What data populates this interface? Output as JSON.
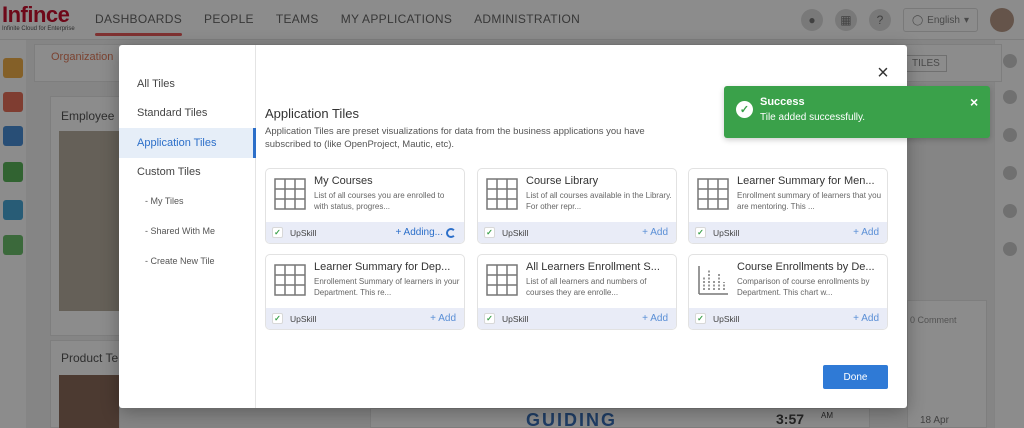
{
  "logo": {
    "name": "Infince",
    "tagline": "Infinite Cloud for Enterprise"
  },
  "nav": [
    "DASHBOARDS",
    "PEOPLE",
    "TEAMS",
    "MY APPLICATIONS",
    "ADMINISTRATION"
  ],
  "topbar": {
    "language": "English"
  },
  "background": {
    "org_label": "Organization",
    "emp_label": "Employee",
    "product_label": "Product Te",
    "tiles_btn": "TILES",
    "comment": "0 Comment",
    "guiding": "GUIDING",
    "time": "3:57",
    "ampm": "AM",
    "date": "18 Apr"
  },
  "sidebar": {
    "items": [
      {
        "label": "All Tiles"
      },
      {
        "label": "Standard Tiles"
      },
      {
        "label": "Application Tiles"
      },
      {
        "label": "Custom Tiles"
      },
      {
        "label": "- My Tiles"
      },
      {
        "label": "- Shared With Me"
      },
      {
        "label": "- Create New Tile"
      }
    ]
  },
  "main": {
    "title": "Application Tiles",
    "description": "Application Tiles are preset visualizations for data from the business applications you have subscribed to (like OpenProject, Mautic, etc).",
    "tiles": [
      {
        "name": "My Courses",
        "desc": "List of all courses you are enrolled to with status, progres...",
        "app": "UpSkill",
        "action": "+ Adding..."
      },
      {
        "name": "Course Library",
        "desc": "List of all courses available in the Library. For other repr...",
        "app": "UpSkill",
        "action": "+ Add"
      },
      {
        "name": "Learner Summary for Men...",
        "desc": "Enrollment summary of learners that you are mentoring. This ...",
        "app": "UpSkill",
        "action": "+ Add"
      },
      {
        "name": "Learner Summary for Dep...",
        "desc": "Enrollement Summary of learners in your Department. This re...",
        "app": "UpSkill",
        "action": "+ Add"
      },
      {
        "name": "All Learners Enrollment S...",
        "desc": "List of all learners and numbers of courses they are enrolle...",
        "app": "UpSkill",
        "action": "+ Add"
      },
      {
        "name": "Course Enrollments by De...",
        "desc": "Comparison of course enrollments by Department. This chart w...",
        "app": "UpSkill",
        "action": "+ Add"
      }
    ],
    "done_label": "Done"
  },
  "toast": {
    "title": "Success",
    "message": "Tile added successfully."
  },
  "colors": {
    "accent": "#2f7ad6",
    "success": "#3aa14a",
    "brand": "#c8102e"
  }
}
